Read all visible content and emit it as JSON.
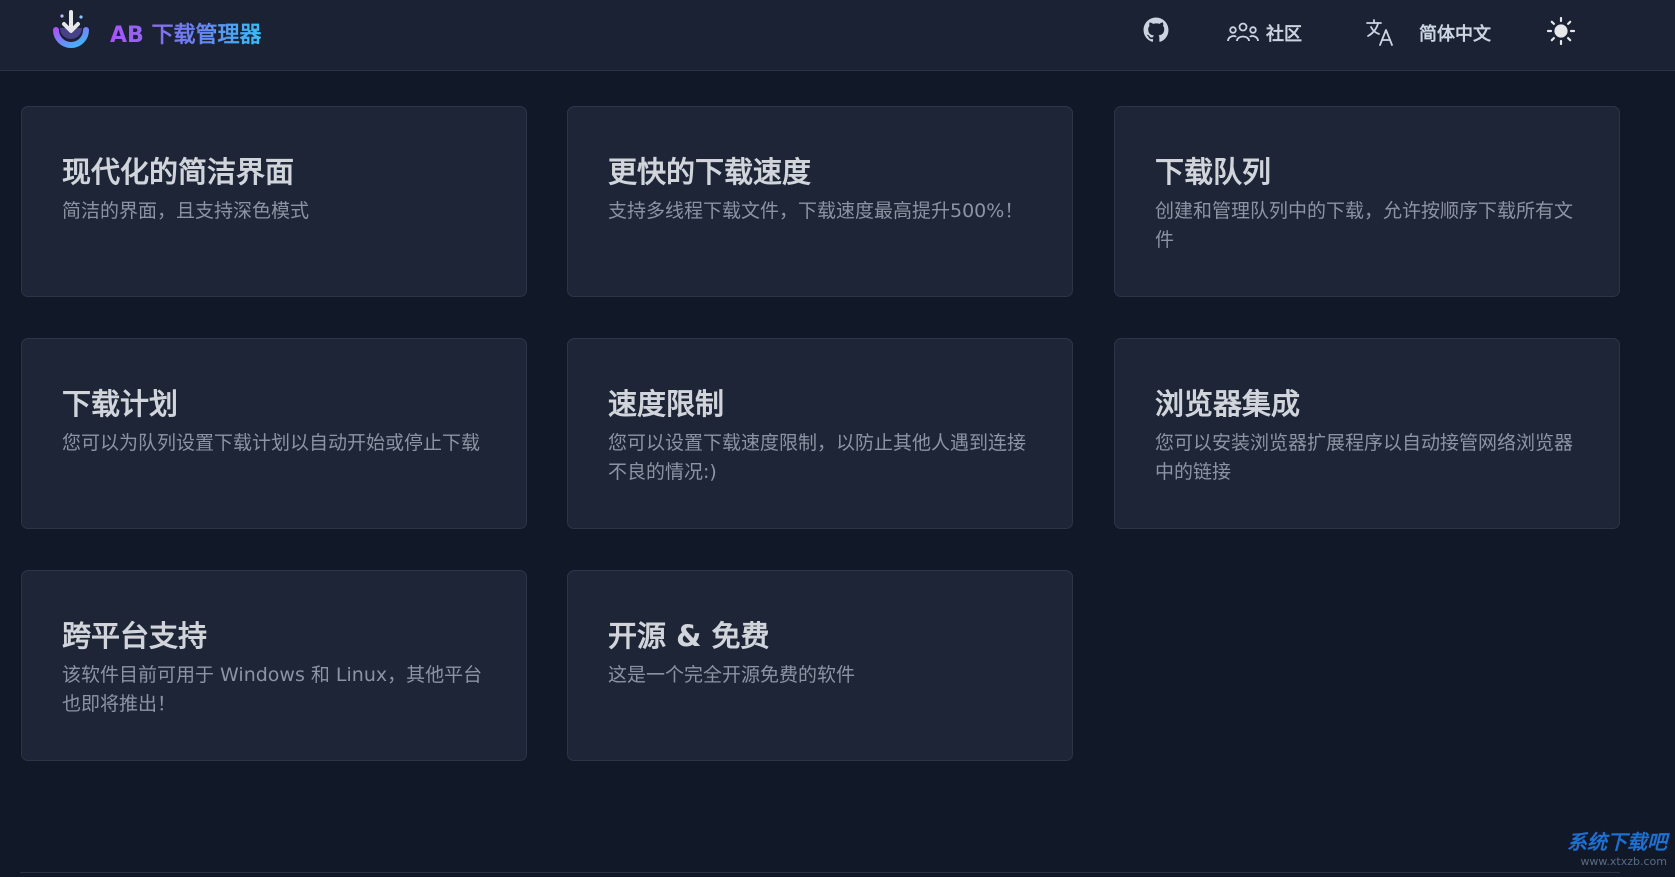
{
  "header": {
    "brand": "AB 下载管理器",
    "community_label": "社区",
    "language_label": "简体中文",
    "icons": [
      "logo-icon",
      "github-icon",
      "community-icon",
      "translate-icon",
      "sun-icon"
    ]
  },
  "features": [
    {
      "title": "现代化的简洁界面",
      "desc": "简洁的界面，且支持深色模式"
    },
    {
      "title": "更快的下载速度",
      "desc": "支持多线程下载文件，下载速度最高提升500%！"
    },
    {
      "title": "下载队列",
      "desc": "创建和管理队列中的下载，允许按顺序下载所有文件"
    },
    {
      "title": "下载计划",
      "desc": "您可以为队列设置下载计划以自动开始或停止下载"
    },
    {
      "title": "速度限制",
      "desc": "您可以设置下载速度限制，以防止其他人遇到连接不良的情况:)"
    },
    {
      "title": "浏览器集成",
      "desc": "您可以安装浏览器扩展程序以自动接管网络浏览器中的链接"
    },
    {
      "title": "跨平台支持",
      "desc": "该软件目前可用于 Windows 和 Linux，其他平台也即将推出！"
    },
    {
      "title": "开源 & 免费",
      "desc": "这是一个完全开源免费的软件"
    }
  ],
  "watermark": {
    "main": "系统下载吧",
    "sub": "www.xtxzb.com"
  },
  "colors": {
    "background": "#111827",
    "card": "#1e2536",
    "brand_gradient_start": "#a855f7",
    "brand_gradient_end": "#38bdf8"
  }
}
